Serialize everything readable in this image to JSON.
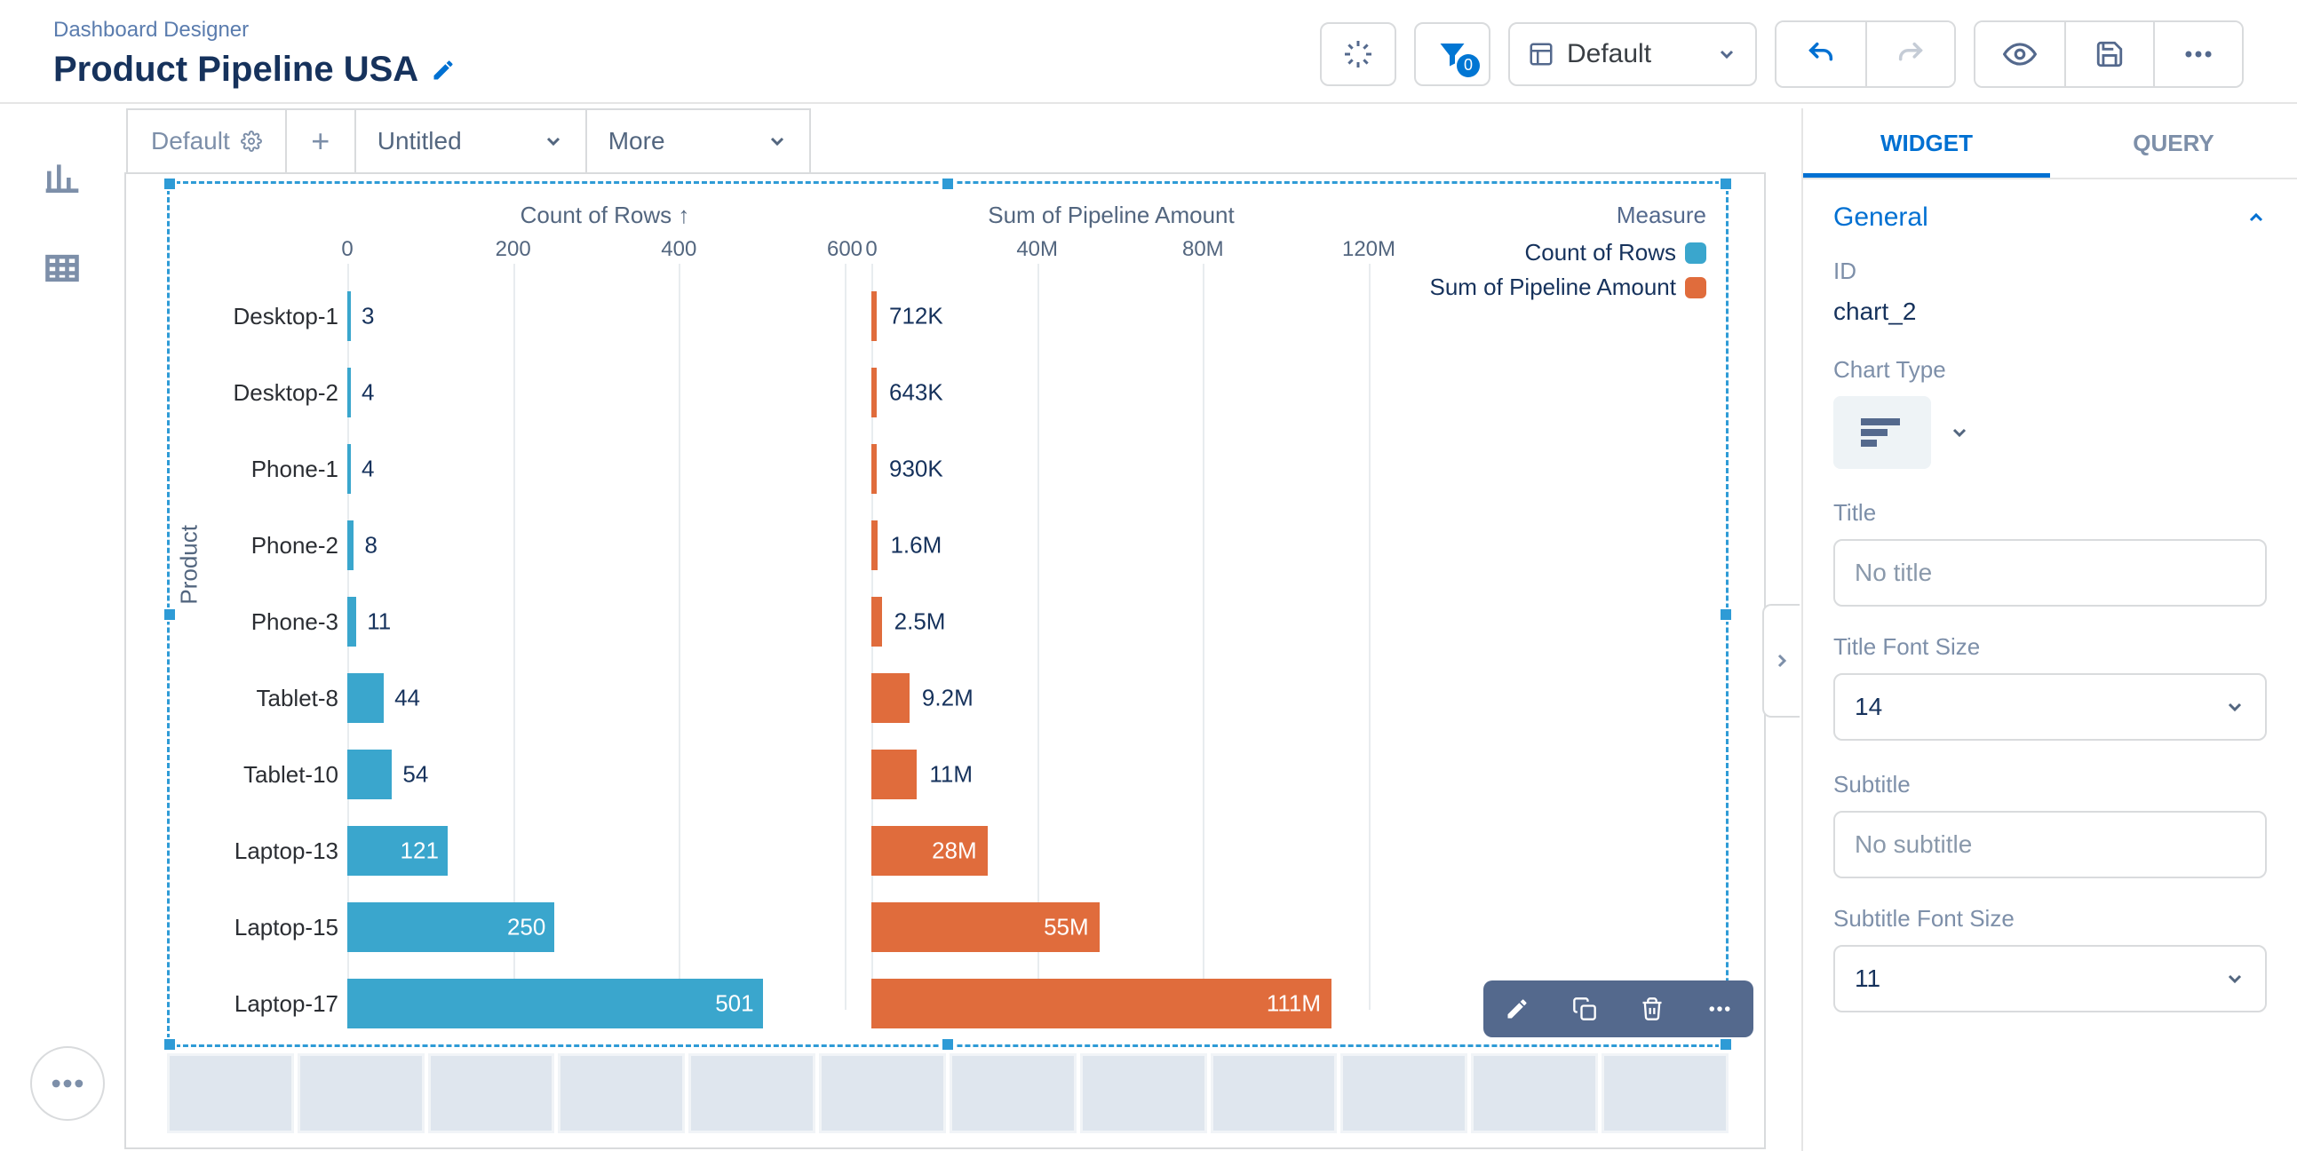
{
  "header": {
    "breadcrumb": "Dashboard Designer",
    "title": "Product Pipeline USA",
    "layout_dropdown": "Default",
    "filter_badge": "0"
  },
  "center_tabs": {
    "default_tab": "Default",
    "untitled_tab": "Untitled",
    "more_tab": "More"
  },
  "right_panel": {
    "tab_widget": "WIDGET",
    "tab_query": "QUERY",
    "section_general": "General",
    "id_label": "ID",
    "id_value": "chart_2",
    "chart_type_label": "Chart Type",
    "title_label": "Title",
    "title_placeholder": "No title",
    "title_font_size_label": "Title Font Size",
    "title_font_size_value": "14",
    "subtitle_label": "Subtitle",
    "subtitle_placeholder": "No subtitle",
    "subtitle_font_size_label": "Subtitle Font Size",
    "subtitle_font_size_value": "11"
  },
  "chart_meta": {
    "series1_title": "Count of Rows ↑",
    "series2_title": "Sum of Pipeline Amount",
    "measure_label": "Measure",
    "legend1": "Count of Rows",
    "legend2": "Sum of Pipeline Amount",
    "y_axis_label": "Product",
    "ticks1": [
      "0",
      "200",
      "400",
      "600"
    ],
    "ticks2": [
      "0",
      "40M",
      "80M",
      "120M"
    ],
    "color_blue": "#3aa6cd",
    "color_orange": "#e06c3c"
  },
  "chart_data": {
    "type": "bar",
    "categories": [
      "Desktop-1",
      "Desktop-2",
      "Phone-1",
      "Phone-2",
      "Phone-3",
      "Tablet-8",
      "Tablet-10",
      "Laptop-13",
      "Laptop-15",
      "Laptop-17"
    ],
    "series": [
      {
        "name": "Count of Rows",
        "color": "#3aa6cd",
        "values": [
          3,
          4,
          4,
          8,
          11,
          44,
          54,
          121,
          250,
          501
        ],
        "labels": [
          "3",
          "4",
          "4",
          "8",
          "11",
          "44",
          "54",
          "121",
          "250",
          "501"
        ],
        "xlim": [
          0,
          600
        ],
        "ticks": [
          0,
          200,
          400,
          600
        ]
      },
      {
        "name": "Sum of Pipeline Amount",
        "color": "#e06c3c",
        "values": [
          712000,
          643000,
          930000,
          1600000,
          2500000,
          9200000,
          11000000,
          28000000,
          55000000,
          111000000
        ],
        "labels": [
          "712K",
          "643K",
          "930K",
          "1.6M",
          "2.5M",
          "9.2M",
          "11M",
          "28M",
          "55M",
          "111M"
        ],
        "xlim": [
          0,
          120000000
        ],
        "ticks": [
          0,
          40000000,
          80000000,
          120000000
        ]
      }
    ],
    "ylabel": "Product",
    "orientation": "horizontal"
  }
}
